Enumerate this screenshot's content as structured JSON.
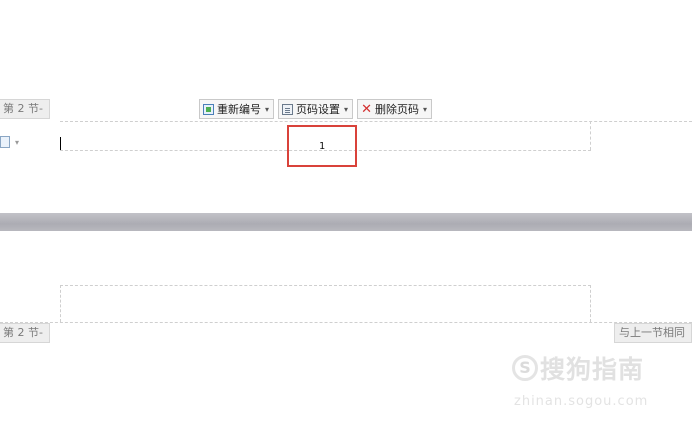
{
  "header": {
    "section_label": "第 2 节-",
    "toolbar": {
      "renumber_label": "重新编号",
      "renumber_icon": "renumber-icon",
      "page_setup_label": "页码设置",
      "page_setup_icon": "page-setup-icon",
      "delete_label": "删除页码",
      "delete_icon": "delete-x-icon",
      "dropdown_glyph": "▾"
    },
    "page_number": "1",
    "highlight_color": "#d9423a"
  },
  "footer": {
    "section_label": "第 2 节-",
    "same_as_previous_label": "与上一节相同"
  },
  "watermark": {
    "logo_glyph": "S",
    "brand_text": "搜狗指南",
    "url": "zhinan.sogou.com"
  }
}
